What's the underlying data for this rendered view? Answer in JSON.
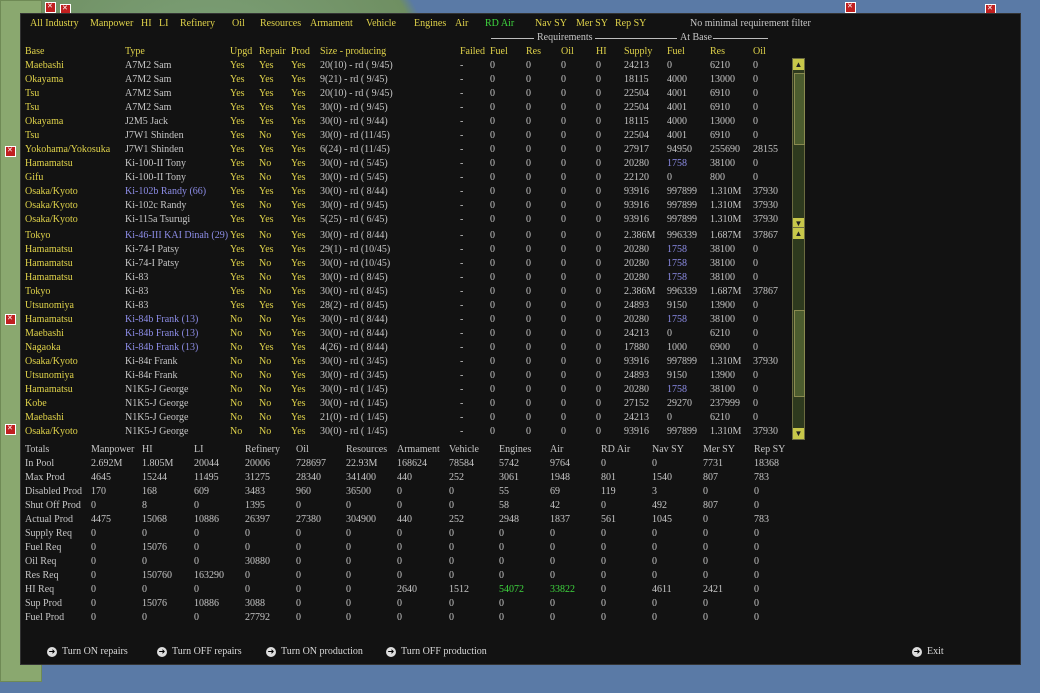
{
  "filter_tabs": [
    {
      "label": "All Industry",
      "active": false
    },
    {
      "label": "Manpower",
      "active": false
    },
    {
      "label": "HI",
      "active": false
    },
    {
      "label": "LI",
      "active": false
    },
    {
      "label": "Refinery",
      "active": false
    },
    {
      "label": "Oil",
      "active": false
    },
    {
      "label": "Resources",
      "active": false
    },
    {
      "label": "Armament",
      "active": false
    },
    {
      "label": "Vehicle",
      "active": false
    },
    {
      "label": "Engines",
      "active": false
    },
    {
      "label": "Air",
      "active": false
    },
    {
      "label": "RD Air",
      "active": true
    },
    {
      "label": "Nav SY",
      "active": false
    },
    {
      "label": "Mer SY",
      "active": false
    },
    {
      "label": "Rep SY",
      "active": false
    }
  ],
  "no_min_filter": "No minimal requirement filter",
  "group_requirements": "Requirements",
  "group_at_base": "At Base",
  "columns": [
    "Base",
    "Type",
    "Upgd",
    "Repair",
    "Prod",
    "Size - producing",
    "Failed",
    "Fuel",
    "Res",
    "Oil",
    "HI",
    "Supply",
    "Fuel",
    "Res",
    "Oil"
  ],
  "rows": [
    [
      "Maebashi",
      "A7M2 Sam",
      "Yes",
      "Yes",
      "Yes",
      "20(10) - rd ( 9/45)",
      "-",
      "0",
      "0",
      "0",
      "0",
      "24213",
      "0",
      "6210",
      "0"
    ],
    [
      "Okayama",
      "A7M2 Sam",
      "Yes",
      "Yes",
      "Yes",
      "9(21) - rd ( 9/45)",
      "-",
      "0",
      "0",
      "0",
      "0",
      "18115",
      "4000",
      "13000",
      "0"
    ],
    [
      "Tsu",
      "A7M2 Sam",
      "Yes",
      "Yes",
      "Yes",
      "20(10) - rd ( 9/45)",
      "-",
      "0",
      "0",
      "0",
      "0",
      "22504",
      "4001",
      "6910",
      "0"
    ],
    [
      "Tsu",
      "A7M2 Sam",
      "Yes",
      "Yes",
      "Yes",
      "30(0) - rd ( 9/45)",
      "-",
      "0",
      "0",
      "0",
      "0",
      "22504",
      "4001",
      "6910",
      "0"
    ],
    [
      "Okayama",
      "J2M5 Jack",
      "Yes",
      "Yes",
      "Yes",
      "30(0) - rd ( 9/44)",
      "-",
      "0",
      "0",
      "0",
      "0",
      "18115",
      "4000",
      "13000",
      "0"
    ],
    [
      "Tsu",
      "J7W1 Shinden",
      "Yes",
      "No",
      "Yes",
      "30(0) - rd (11/45)",
      "-",
      "0",
      "0",
      "0",
      "0",
      "22504",
      "4001",
      "6910",
      "0"
    ],
    [
      "Yokohama/Yokosuka",
      "J7W1 Shinden",
      "Yes",
      "Yes",
      "Yes",
      "6(24) - rd (11/45)",
      "-",
      "0",
      "0",
      "0",
      "0",
      "27917",
      "94950",
      "255690",
      "28155"
    ],
    [
      "Hamamatsu",
      "Ki-100-II Tony",
      "Yes",
      "No",
      "Yes",
      "30(0) - rd ( 5/45)",
      "-",
      "0",
      "0",
      "0",
      "0",
      "20280",
      "1758",
      "38100",
      "0"
    ],
    [
      "Gifu",
      "Ki-100-II Tony",
      "Yes",
      "No",
      "Yes",
      "30(0) - rd ( 5/45)",
      "-",
      "0",
      "0",
      "0",
      "0",
      "22120",
      "0",
      "800",
      "0"
    ],
    [
      "Osaka/Kyoto",
      "Ki-102b Randy (66)",
      "Yes",
      "Yes",
      "Yes",
      "30(0) - rd ( 8/44)",
      "-",
      "0",
      "0",
      "0",
      "0",
      "93916",
      "997899",
      "1.310M",
      "37930"
    ],
    [
      "Osaka/Kyoto",
      "Ki-102c Randy",
      "Yes",
      "No",
      "Yes",
      "30(0) - rd ( 9/45)",
      "-",
      "0",
      "0",
      "0",
      "0",
      "93916",
      "997899",
      "1.310M",
      "37930"
    ],
    [
      "Osaka/Kyoto",
      "Ki-115a Tsurugi",
      "Yes",
      "Yes",
      "Yes",
      "5(25) - rd ( 6/45)",
      "-",
      "0",
      "0",
      "0",
      "0",
      "93916",
      "997899",
      "1.310M",
      "37930"
    ],
    [
      "Tokyo",
      "Ki-46-III KAI Dinah (29)",
      "Yes",
      "No",
      "Yes",
      "30(0) - rd ( 8/44)",
      "-",
      "0",
      "0",
      "0",
      "0",
      "2.386M",
      "996339",
      "1.687M",
      "37867"
    ],
    [
      "Hamamatsu",
      "Ki-74-I Patsy",
      "Yes",
      "Yes",
      "Yes",
      "29(1) - rd (10/45)",
      "-",
      "0",
      "0",
      "0",
      "0",
      "20280",
      "1758",
      "38100",
      "0"
    ],
    [
      "Hamamatsu",
      "Ki-74-I Patsy",
      "Yes",
      "No",
      "Yes",
      "30(0) - rd (10/45)",
      "-",
      "0",
      "0",
      "0",
      "0",
      "20280",
      "1758",
      "38100",
      "0"
    ],
    [
      "Hamamatsu",
      "Ki-83",
      "Yes",
      "No",
      "Yes",
      "30(0) - rd ( 8/45)",
      "-",
      "0",
      "0",
      "0",
      "0",
      "20280",
      "1758",
      "38100",
      "0"
    ],
    [
      "Tokyo",
      "Ki-83",
      "Yes",
      "No",
      "Yes",
      "30(0) - rd ( 8/45)",
      "-",
      "0",
      "0",
      "0",
      "0",
      "2.386M",
      "996339",
      "1.687M",
      "37867"
    ],
    [
      "Utsunomiya",
      "Ki-83",
      "Yes",
      "Yes",
      "Yes",
      "28(2) - rd ( 8/45)",
      "-",
      "0",
      "0",
      "0",
      "0",
      "24893",
      "9150",
      "13900",
      "0"
    ],
    [
      "Hamamatsu",
      "Ki-84b Frank (13)",
      "No",
      "No",
      "Yes",
      "30(0) - rd ( 8/44)",
      "-",
      "0",
      "0",
      "0",
      "0",
      "20280",
      "1758",
      "38100",
      "0"
    ],
    [
      "Maebashi",
      "Ki-84b Frank (13)",
      "No",
      "No",
      "Yes",
      "30(0) - rd ( 8/44)",
      "-",
      "0",
      "0",
      "0",
      "0",
      "24213",
      "0",
      "6210",
      "0"
    ],
    [
      "Nagaoka",
      "Ki-84b Frank (13)",
      "No",
      "Yes",
      "Yes",
      "4(26) - rd ( 8/44)",
      "-",
      "0",
      "0",
      "0",
      "0",
      "17880",
      "1000",
      "6900",
      "0"
    ],
    [
      "Osaka/Kyoto",
      "Ki-84r Frank",
      "No",
      "No",
      "Yes",
      "30(0) - rd ( 3/45)",
      "-",
      "0",
      "0",
      "0",
      "0",
      "93916",
      "997899",
      "1.310M",
      "37930"
    ],
    [
      "Utsunomiya",
      "Ki-84r Frank",
      "No",
      "No",
      "Yes",
      "30(0) - rd ( 3/45)",
      "-",
      "0",
      "0",
      "0",
      "0",
      "24893",
      "9150",
      "13900",
      "0"
    ],
    [
      "Hamamatsu",
      "N1K5-J George",
      "No",
      "No",
      "Yes",
      "30(0) - rd ( 1/45)",
      "-",
      "0",
      "0",
      "0",
      "0",
      "20280",
      "1758",
      "38100",
      "0"
    ],
    [
      "Kobe",
      "N1K5-J George",
      "No",
      "No",
      "Yes",
      "30(0) - rd ( 1/45)",
      "-",
      "0",
      "0",
      "0",
      "0",
      "27152",
      "29270",
      "237999",
      "0"
    ],
    [
      "Maebashi",
      "N1K5-J George",
      "No",
      "No",
      "Yes",
      "21(0) - rd ( 1/45)",
      "-",
      "0",
      "0",
      "0",
      "0",
      "24213",
      "0",
      "6210",
      "0"
    ],
    [
      "Osaka/Kyoto",
      "N1K5-J George",
      "No",
      "No",
      "Yes",
      "30(0) - rd ( 1/45)",
      "-",
      "0",
      "0",
      "0",
      "0",
      "93916",
      "997899",
      "1.310M",
      "37930"
    ]
  ],
  "blue_types": [
    9,
    12,
    18,
    19,
    20
  ],
  "blue_fuel_rows": [
    7,
    13,
    14,
    15,
    18,
    23
  ],
  "totals_header": [
    "Totals",
    "Manpower",
    "HI",
    "LI",
    "Refinery",
    "Oil",
    "Resources",
    "Armament",
    "Vehicle",
    "Engines",
    "Air",
    "RD Air",
    "Nav SY",
    "Mer SY",
    "Rep SY"
  ],
  "totals_rows": [
    [
      "In Pool",
      "2.692M",
      "1.805M",
      "20044",
      "20006",
      "728697",
      "22.93M",
      "168624",
      "78584",
      "5742",
      "9764",
      "0",
      "0",
      "7731",
      "18368"
    ],
    [
      "Max Prod",
      "4645",
      "15244",
      "11495",
      "31275",
      "28340",
      "341400",
      "440",
      "252",
      "3061",
      "1948",
      "801",
      "1540",
      "807",
      "783"
    ],
    [
      "Disabled Prod",
      "170",
      "168",
      "609",
      "3483",
      "960",
      "36500",
      "0",
      "0",
      "55",
      "69",
      "119",
      "3",
      "0",
      "0"
    ],
    [
      "Shut Off Prod",
      "0",
      "8",
      "0",
      "1395",
      "0",
      "0",
      "0",
      "0",
      "58",
      "42",
      "0",
      "492",
      "807",
      "0"
    ],
    [
      "Actual Prod",
      "4475",
      "15068",
      "10886",
      "26397",
      "27380",
      "304900",
      "440",
      "252",
      "2948",
      "1837",
      "561",
      "1045",
      "0",
      "783"
    ],
    [
      "Supply Req",
      "0",
      "0",
      "0",
      "0",
      "0",
      "0",
      "0",
      "0",
      "0",
      "0",
      "0",
      "0",
      "0",
      "0"
    ],
    [
      "Fuel Req",
      "0",
      "15076",
      "0",
      "0",
      "0",
      "0",
      "0",
      "0",
      "0",
      "0",
      "0",
      "0",
      "0",
      "0"
    ],
    [
      "Oil Req",
      "0",
      "0",
      "0",
      "30880",
      "0",
      "0",
      "0",
      "0",
      "0",
      "0",
      "0",
      "0",
      "0",
      "0"
    ],
    [
      "Res Req",
      "0",
      "150760",
      "163290",
      "0",
      "0",
      "0",
      "0",
      "0",
      "0",
      "0",
      "0",
      "0",
      "0",
      "0"
    ],
    [
      "HI Req",
      "0",
      "0",
      "0",
      "0",
      "0",
      "0",
      "2640",
      "1512",
      "54072",
      "33822",
      "0",
      "4611",
      "2421",
      "0"
    ],
    [
      "Sup Prod",
      "0",
      "15076",
      "10886",
      "3088",
      "0",
      "0",
      "0",
      "0",
      "0",
      "0",
      "0",
      "0",
      "0",
      "0"
    ],
    [
      "Fuel Prod",
      "0",
      "0",
      "0",
      "27792",
      "0",
      "0",
      "0",
      "0",
      "0",
      "0",
      "0",
      "0",
      "0",
      "0"
    ]
  ],
  "buttons": {
    "turn_on_repairs": "Turn ON repairs",
    "turn_off_repairs": "Turn OFF repairs",
    "turn_on_production": "Turn ON production",
    "turn_off_production": "Turn OFF production",
    "exit": "Exit"
  },
  "icons": {
    "button": "arrow-right-icon",
    "scroll_up": "arrow-up-icon",
    "scroll_down": "arrow-down-icon"
  },
  "colors": {
    "label": "#e0d34a",
    "value": "#c6c6c6",
    "highlight": "#3ed63e",
    "link": "#8c8ce6",
    "panel": "#121212"
  }
}
